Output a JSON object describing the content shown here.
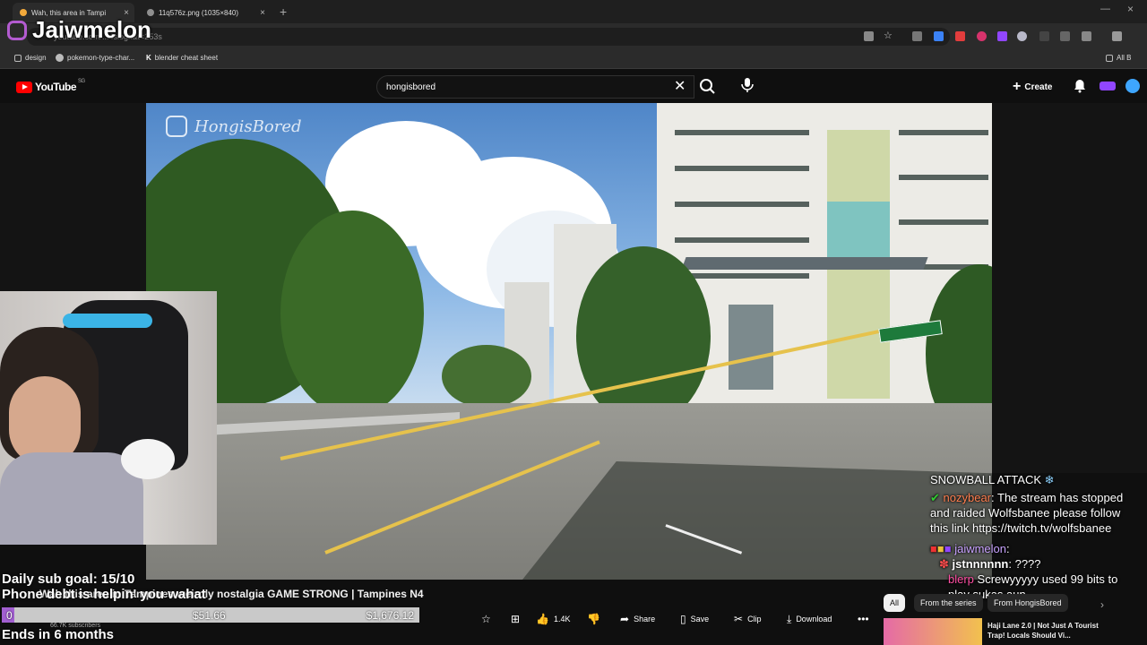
{
  "browser": {
    "tabs": [
      {
        "label": "Wah, this area in Tampi",
        "active": true
      },
      {
        "label": "11q576z.png (1035×840)",
        "active": false
      }
    ],
    "url": "youtube.com/...4slogk&t=253s",
    "bookmarks": [
      "design",
      "pokemon-type-char...",
      "blender cheat sheet",
      "All B"
    ]
  },
  "youtube": {
    "logo_text": "YouTube",
    "logo_sup": "SG",
    "search_value": "hongisbored",
    "create_label": "Create",
    "video": {
      "watermark": "HongisBored",
      "title": "Wah this area in Tampines weirdly nostalgia GAME STRONG | Tampines N4",
      "subscribers": "66.7K subscribers",
      "actions": {
        "like_count": "1.4K",
        "share_label": "Share",
        "save_label": "Save",
        "clip_label": "Clip",
        "download_label": "Download"
      }
    },
    "sidebar": {
      "chips": [
        "All",
        "From the series",
        "From HongisBored"
      ],
      "related_title": "Haji Lane 2.0 | Not Just A Tourist Trap! Locals Should Vi..."
    }
  },
  "overlay": {
    "streamer_name": "Jaiwmelon",
    "sub_goal": "Daily sub goal: 15/10",
    "phone_text": "Phone debt is helpin' you wahat",
    "goal_start": "$51.66",
    "goal_end": "$1,676.12",
    "goal_progress": 0.03,
    "ends_text": "Ends in 6 months",
    "goal_left_value": "0"
  },
  "chat": {
    "event_title": "SNOWBALL ATTACK",
    "messages": [
      {
        "user": "nozybear",
        "text": "The stream has stopped and raided Wolfsbanee please follow this link https://twitch.tv/wolfsbanee",
        "user_color": "#ff7f50"
      },
      {
        "user": "jaiwmelon",
        "text": "",
        "user_color": "#c9a3ff"
      },
      {
        "user": "jstnnnnnn",
        "text": "????",
        "user_color": "#ffffff"
      },
      {
        "user": "blerp",
        "text": "Screwyyyyy used 99 bits to play sukas aun",
        "user_color": "#ff4fa3"
      }
    ]
  },
  "colors": {
    "youtube_red": "#ff0000",
    "twitch_purple": "#9146ff",
    "goal_fill": "#a25fd1"
  }
}
